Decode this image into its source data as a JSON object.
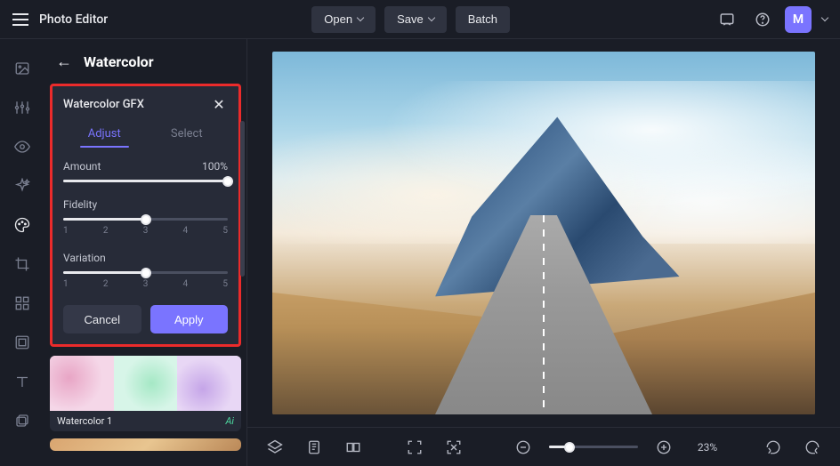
{
  "app_title": "Photo Editor",
  "top_buttons": {
    "open": "Open",
    "save": "Save",
    "batch": "Batch"
  },
  "avatar_letter": "M",
  "panel": {
    "title": "Watercolor"
  },
  "gfx": {
    "title": "Watercolor GFX",
    "tabs": {
      "adjust": "Adjust",
      "select": "Select"
    },
    "controls": {
      "amount": {
        "label": "Amount",
        "value_text": "100%",
        "fill_pct": 100
      },
      "fidelity": {
        "label": "Fidelity",
        "value": 3,
        "ticks": [
          "1",
          "2",
          "3",
          "4",
          "5"
        ],
        "fill_pct": 50
      },
      "variation": {
        "label": "Variation",
        "value": 3,
        "ticks": [
          "1",
          "2",
          "3",
          "4",
          "5"
        ],
        "fill_pct": 50
      }
    },
    "buttons": {
      "cancel": "Cancel",
      "apply": "Apply"
    }
  },
  "thumbs": {
    "watercolor1": {
      "label": "Watercolor 1",
      "badge": "Ai"
    }
  },
  "zoom": {
    "value": "23%"
  }
}
